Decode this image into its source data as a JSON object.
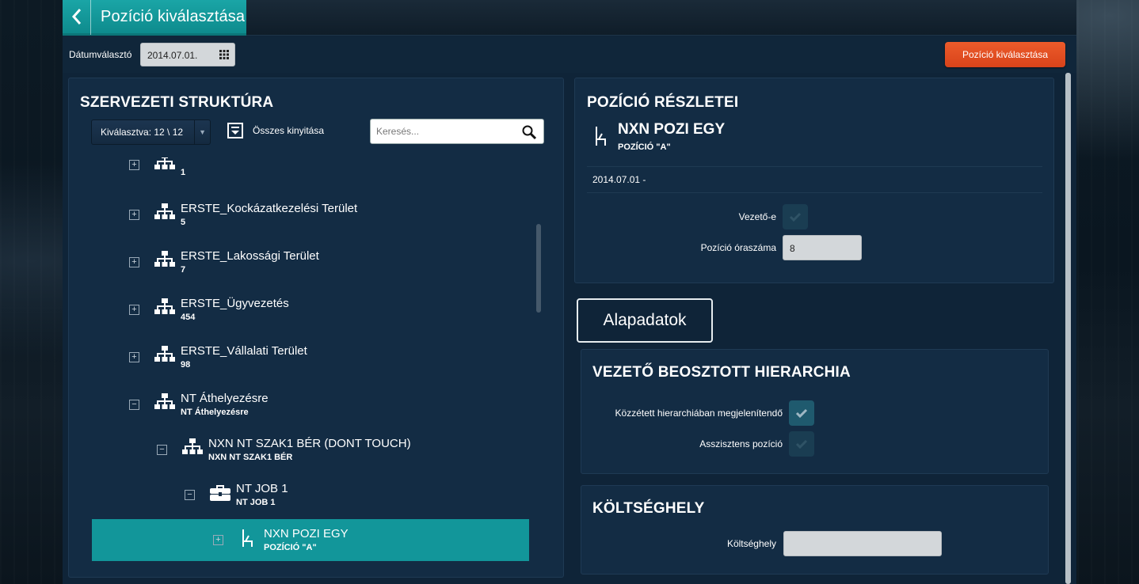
{
  "header": {
    "title": "Pozíció kiválasztása",
    "back_icon": "chevron-left-icon"
  },
  "toolbar": {
    "date_label": "Dátumválasztó",
    "date_value": "2014.07.01.",
    "select_button": "Pozíció kiválasztása"
  },
  "structure": {
    "title": "SZERVEZETI STRUKTÚRA",
    "selected_dropdown": "Kiválasztva: 12 \\ 12",
    "expand_all": "Összes kinyitása",
    "search_placeholder": "Keresés...",
    "nodes": [
      {
        "name": "",
        "sub": "1",
        "icon": "org-chart-icon",
        "toggle": "+"
      },
      {
        "name": "ERSTE_Kockázatkezelési Terület",
        "sub": "5",
        "icon": "org-chart-icon",
        "toggle": "+"
      },
      {
        "name": "ERSTE_Lakossági Terület",
        "sub": "7",
        "icon": "org-chart-icon",
        "toggle": "+"
      },
      {
        "name": "ERSTE_Ügyvezetés",
        "sub": "454",
        "icon": "org-chart-icon",
        "toggle": "+"
      },
      {
        "name": "ERSTE_Vállalati Terület",
        "sub": "98",
        "icon": "org-chart-icon",
        "toggle": "+"
      },
      {
        "name": "NT Áthelyezésre",
        "sub": "NT Áthelyezésre",
        "icon": "org-chart-icon",
        "toggle": "−"
      },
      {
        "name": "NXN NT SZAK1 BÉR (DONT TOUCH)",
        "sub": "NXN NT SZAK1 BÉR",
        "icon": "org-chart-icon",
        "toggle": "−"
      },
      {
        "name": "NT JOB 1",
        "sub": "NT JOB 1",
        "icon": "briefcase-icon",
        "toggle": "−"
      },
      {
        "name": "NXN POZI EGY",
        "sub": "POZÍCIÓ \"A\"",
        "icon": "chair-icon",
        "toggle": "+",
        "selected": true
      }
    ]
  },
  "details": {
    "title": "POZÍCIÓ RÉSZLETEI",
    "position_name": "NXN POZI EGY",
    "position_sub": "POZÍCIÓ \"A\"",
    "date_range": "2014.07.01  -",
    "is_manager_label": "Vezető-e",
    "is_manager": false,
    "hours_label": "Pozíció óraszáma",
    "hours_value": "8"
  },
  "tabs": {
    "basic_data": "Alapadatok"
  },
  "hierarchy": {
    "title": "VEZETŐ BEOSZTOTT HIERARCHIA",
    "show_in_hierarchy_label": "Közzétett hierarchiában megjelenítendő",
    "show_in_hierarchy": true,
    "assistant_label": "Asszisztens pozíció",
    "assistant": false
  },
  "cost_center": {
    "title": "KÖLTSÉGHELY",
    "label": "Költséghely",
    "value": ""
  },
  "colors": {
    "accent": "#12969a",
    "action": "#e24e22",
    "panel": "#132c44"
  }
}
